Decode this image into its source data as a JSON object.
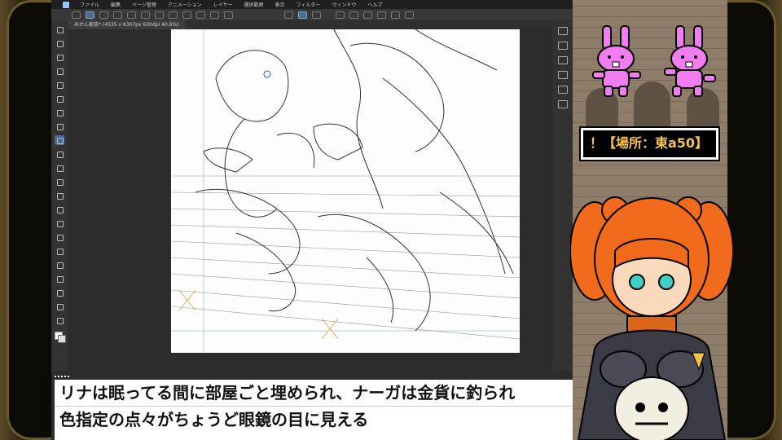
{
  "app": {
    "menu": [
      "ファイル",
      "編集",
      "ページ管理",
      "アニメーション",
      "レイヤー",
      "選択範囲",
      "表示",
      "フィルター",
      "ウィンドウ",
      "ヘルプ"
    ],
    "document_tab": "みかん家族* (4535 x 6307px 600dpi 40.6%)"
  },
  "location_tag": "！【場所：東a50】",
  "subtitles": {
    "line1": "リナは眠ってる間に部屋ごと埋められ、ナーガは金貨に釣られ",
    "line2": "色指定の点々がちょうど眼鏡の目に見える"
  },
  "colors": {
    "accent": "#4a6a98",
    "tag_text": "#f6c24a",
    "bunny": "#f07ef0",
    "hair": "#f26a1b",
    "frame_gold": "#6b5a2c"
  },
  "icons": [
    "pen-tool-icon",
    "move-icon",
    "zoom-icon",
    "lasso-icon",
    "eraser-icon",
    "fill-icon",
    "text-icon",
    "ruler-icon"
  ]
}
